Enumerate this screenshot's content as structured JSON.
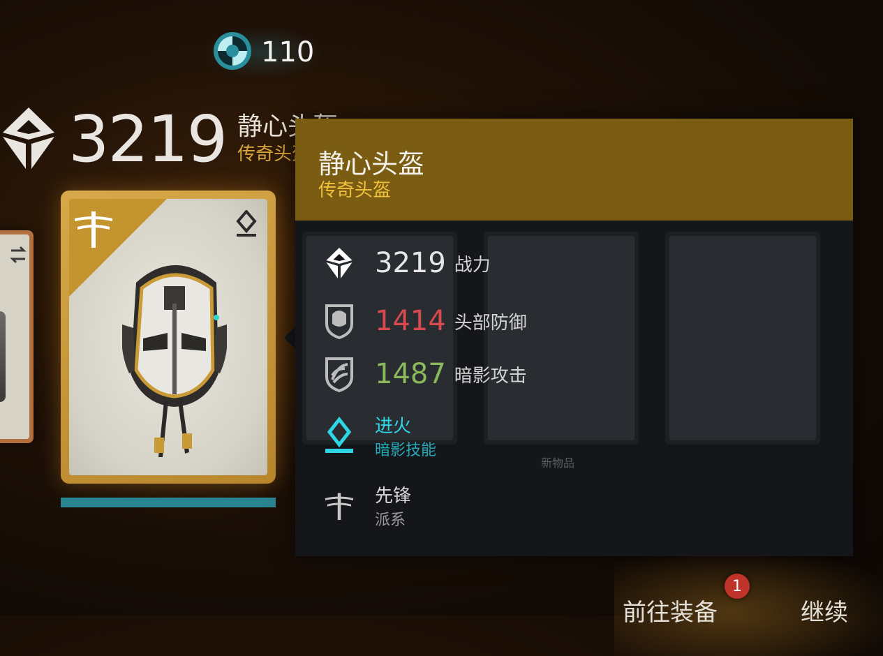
{
  "currency": {
    "icon": "shadow-orb-icon",
    "value": "110",
    "color": "#2a8f9c"
  },
  "item": {
    "power": "3219",
    "name": "静心头盔",
    "rarity": "传奇头盔",
    "rarity_color": "#d9a93b",
    "card_color": "#c4952f",
    "progress_bar_color": "#2b8591"
  },
  "tooltip": {
    "title": "静心头盔",
    "subtitle": "传奇头盔",
    "header_color": "#7a5c13",
    "stats": [
      {
        "icon": "power-diamond-icon",
        "value": "3219",
        "label": "战力",
        "color": "#e6e6e6"
      },
      {
        "icon": "helmet-shield-icon",
        "value": "1414",
        "label": "头部防御",
        "color": "#d94a50"
      },
      {
        "icon": "shadow-claw-shield-icon",
        "value": "1487",
        "label": "暗影攻击",
        "color": "#8ab85a"
      }
    ],
    "skill": {
      "icon": "shadow-skill-pin-icon",
      "name": "进火",
      "type": "暗影技能",
      "color": "#2fd6e6"
    },
    "faction": {
      "icon": "vanguard-dragonfly-icon",
      "name": "先锋",
      "type": "派系"
    },
    "background_label": "新物品"
  },
  "actions": {
    "equip": "前往装备",
    "continue": "继续",
    "badge": "1"
  }
}
